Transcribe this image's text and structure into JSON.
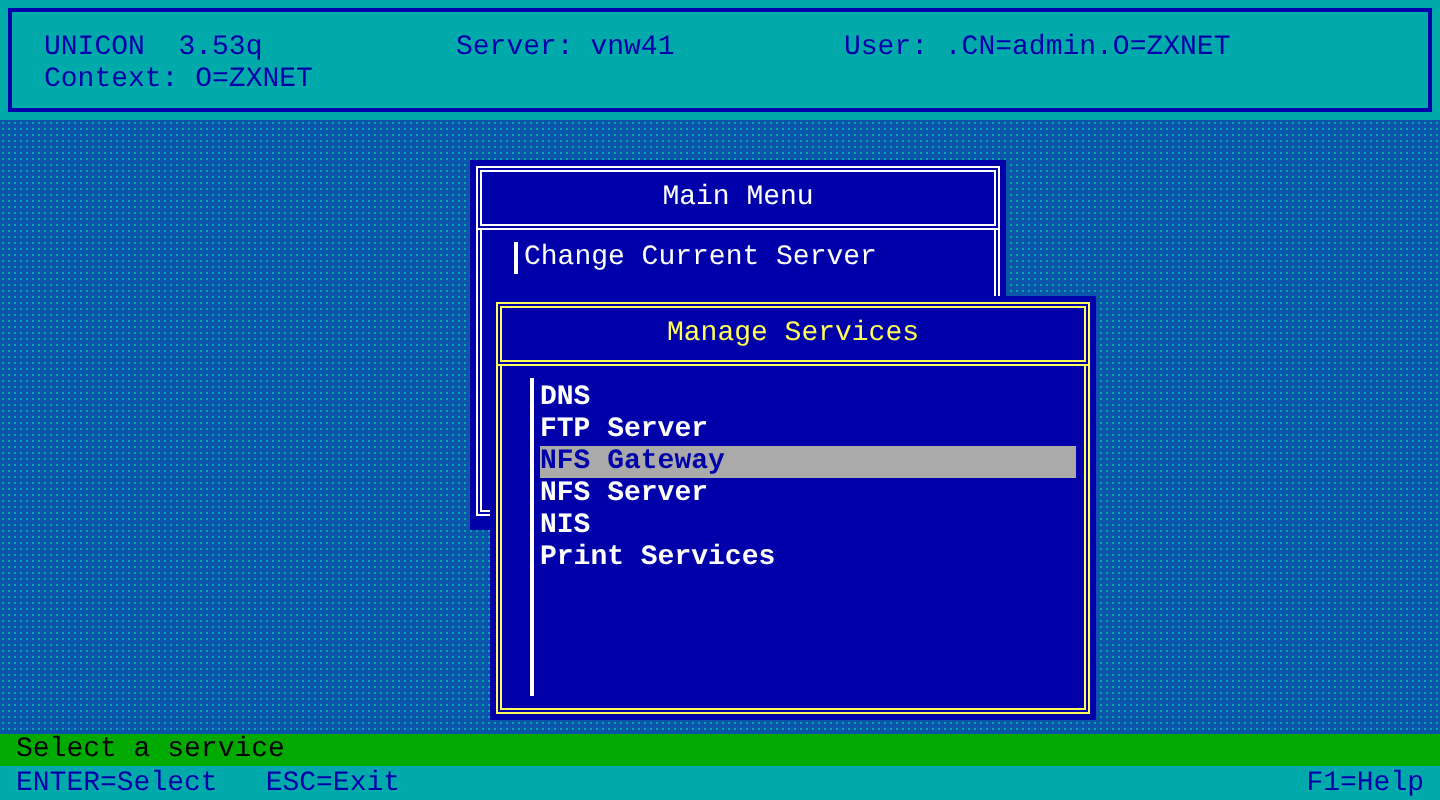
{
  "header": {
    "app": "UNICON  3.53q",
    "server": "Server: vnw41",
    "user": "User: .CN=admin.O=ZXNET",
    "context": "Context: O=ZXNET"
  },
  "main_menu": {
    "title": "Main Menu",
    "items": [
      "Change Current Server"
    ]
  },
  "services_menu": {
    "title": "Manage Services",
    "items": [
      {
        "label": "DNS",
        "selected": false
      },
      {
        "label": "FTP Server",
        "selected": false
      },
      {
        "label": "NFS Gateway",
        "selected": true
      },
      {
        "label": "NFS Server",
        "selected": false
      },
      {
        "label": "NIS",
        "selected": false
      },
      {
        "label": "Print Services",
        "selected": false
      }
    ]
  },
  "status": "Select a service",
  "keys": {
    "left": [
      "ENTER=Select",
      "ESC=Exit"
    ],
    "right": "F1=Help"
  }
}
